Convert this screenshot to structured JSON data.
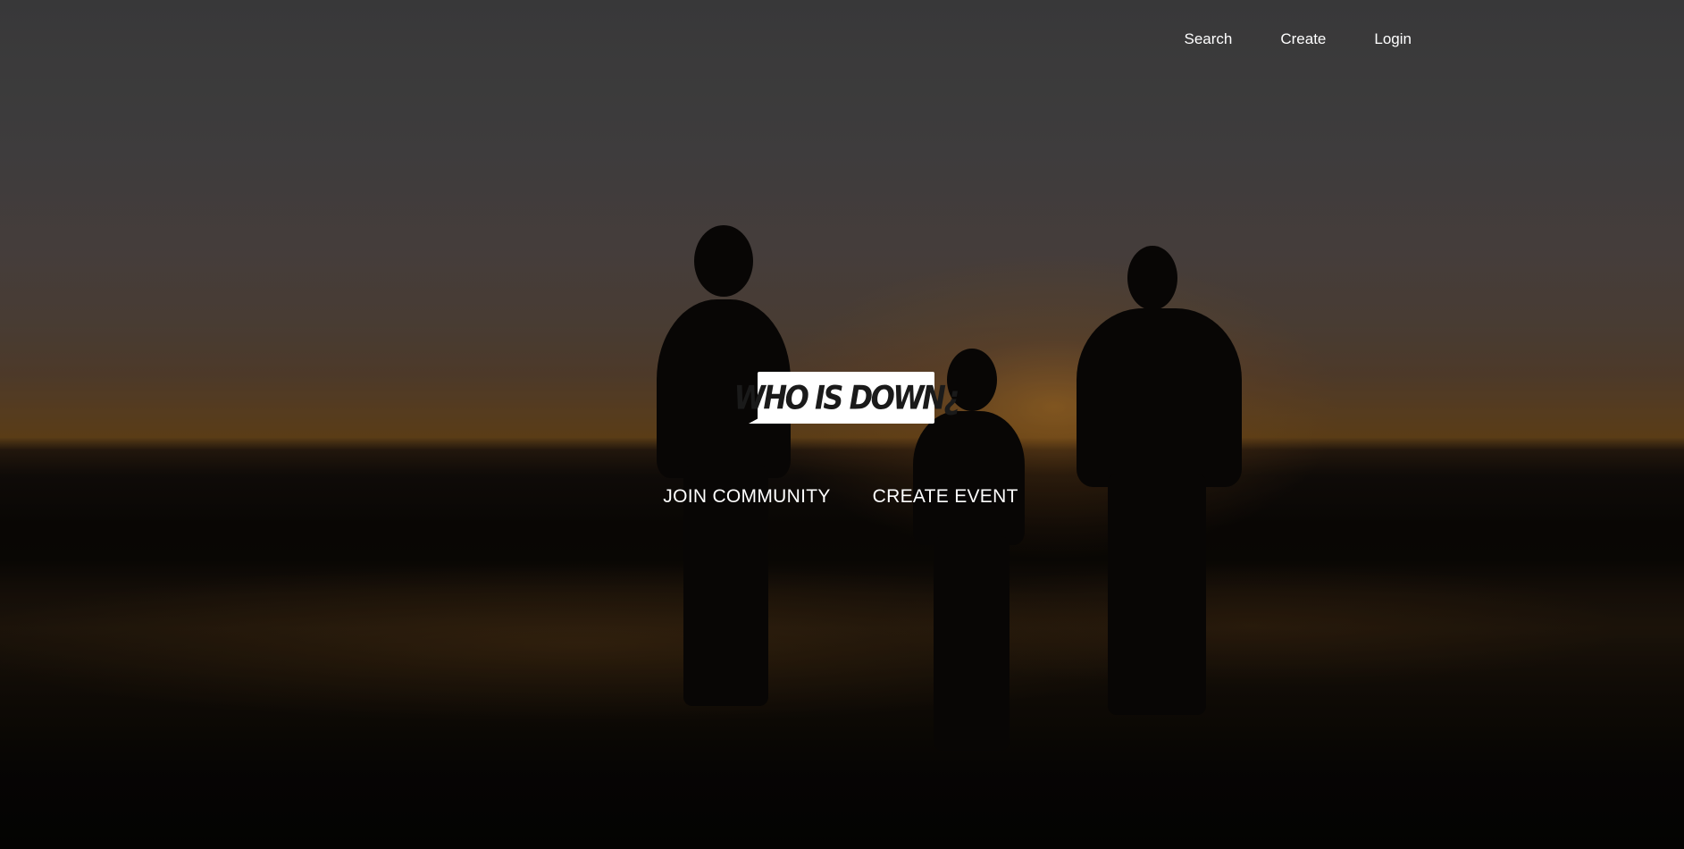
{
  "nav": {
    "links": [
      {
        "label": "Search"
      },
      {
        "label": "Create"
      },
      {
        "label": "Login"
      }
    ]
  },
  "logo": {
    "text": "WHO IS DOWN¿"
  },
  "cta": {
    "join_label": "JOIN COMMUNITY",
    "create_label": "CREATE EVENT"
  },
  "colors": {
    "text": "#ffffff",
    "logo_background": "#ffffff",
    "logo_text": "#1a1a1a"
  }
}
